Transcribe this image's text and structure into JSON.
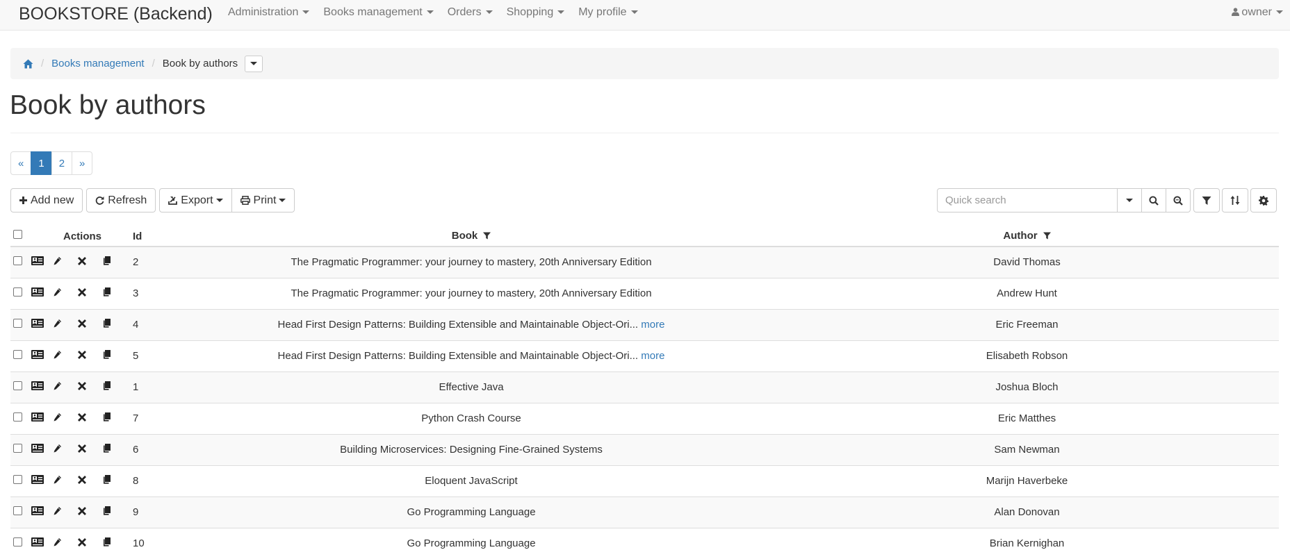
{
  "navbar": {
    "brand": "BOOKSTORE (Backend)",
    "items": [
      {
        "label": "Administration"
      },
      {
        "label": "Books management"
      },
      {
        "label": "Orders"
      },
      {
        "label": "Shopping"
      },
      {
        "label": "My profile"
      }
    ],
    "user": "owner"
  },
  "breadcrumb": {
    "parent": "Books management",
    "current": "Book by authors"
  },
  "page": {
    "title": "Book by authors"
  },
  "pagination": {
    "prev": "«",
    "pages": [
      "1",
      "2"
    ],
    "next": "»",
    "current": "1"
  },
  "toolbar": {
    "add_new": "Add new",
    "refresh": "Refresh",
    "export": "Export",
    "print": "Print"
  },
  "search": {
    "placeholder": "Quick search"
  },
  "table": {
    "headers": {
      "actions": "Actions",
      "id": "Id",
      "book": "Book",
      "author": "Author"
    },
    "more_label": "more",
    "rows": [
      {
        "id": "2",
        "book": "The Pragmatic Programmer: your journey to mastery, 20th Anniversary Edition",
        "more": false,
        "author": "David Thomas"
      },
      {
        "id": "3",
        "book": "The Pragmatic Programmer: your journey to mastery, 20th Anniversary Edition",
        "more": false,
        "author": "Andrew Hunt"
      },
      {
        "id": "4",
        "book": "Head First Design Patterns: Building Extensible and Maintainable Object-Ori...",
        "more": true,
        "author": "Eric Freeman"
      },
      {
        "id": "5",
        "book": "Head First Design Patterns: Building Extensible and Maintainable Object-Ori...",
        "more": true,
        "author": "Elisabeth Robson"
      },
      {
        "id": "1",
        "book": "Effective Java",
        "more": false,
        "author": "Joshua Bloch"
      },
      {
        "id": "7",
        "book": "Python Crash Course",
        "more": false,
        "author": "Eric Matthes"
      },
      {
        "id": "6",
        "book": "Building Microservices: Designing Fine-Grained Systems",
        "more": false,
        "author": "Sam Newman"
      },
      {
        "id": "8",
        "book": "Eloquent JavaScript",
        "more": false,
        "author": "Marijn Haverbeke"
      },
      {
        "id": "9",
        "book": "Go Programming Language",
        "more": false,
        "author": "Alan Donovan"
      },
      {
        "id": "10",
        "book": "Go Programming Language",
        "more": false,
        "author": "Brian Kernighan"
      }
    ]
  },
  "colors": {
    "link": "#337ab7",
    "active_page": "#337ab7"
  }
}
